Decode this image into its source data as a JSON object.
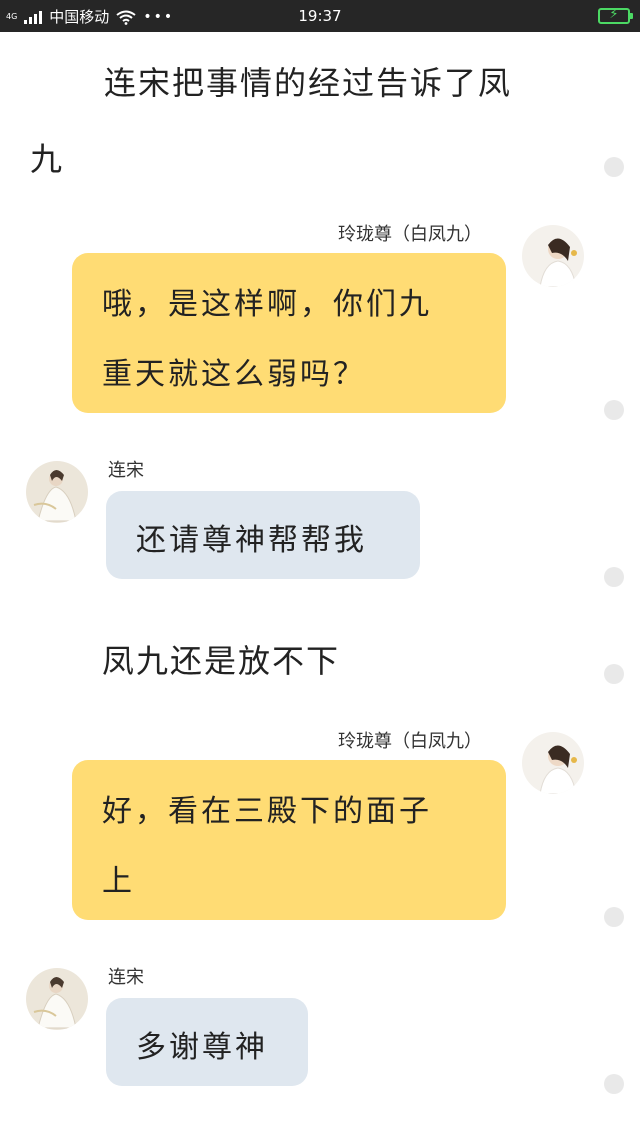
{
  "status_bar": {
    "network": "4G",
    "carrier": "中国移动",
    "time": "19:37",
    "more": "•••"
  },
  "narration": [
    {
      "lines": [
        "连宋把事情的经过告诉了凤",
        "九"
      ]
    },
    {
      "lines": [
        "凤九还是放不下"
      ]
    }
  ],
  "messages": [
    {
      "sender": "玲珑尊（白凤九）",
      "side": "right",
      "lines": [
        "哦，是这样啊，你们九",
        "重天就这么弱吗？"
      ]
    },
    {
      "sender": "连宋",
      "side": "left",
      "lines": [
        "还请尊神帮帮我"
      ]
    },
    {
      "sender": "玲珑尊（白凤九）",
      "side": "right",
      "lines": [
        "好，看在三殿下的面子",
        "上"
      ]
    },
    {
      "sender": "连宋",
      "side": "left",
      "lines": [
        "多谢尊神"
      ]
    }
  ],
  "colors": {
    "right_bubble": "#ffdc74",
    "left_bubble": "#dfe7ef",
    "status_bar": "#262626",
    "battery": "#4cd964"
  }
}
